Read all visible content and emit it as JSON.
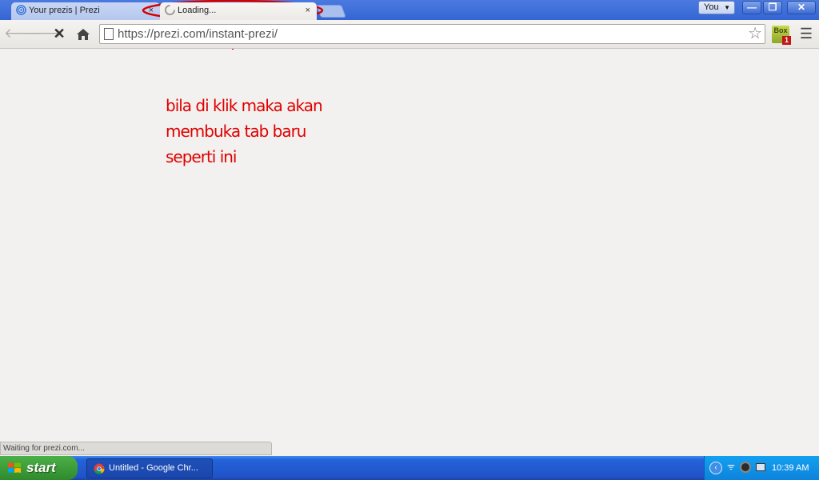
{
  "browser": {
    "tabs": [
      {
        "title": "Your prezis | Prezi",
        "icon": "prezi-icon",
        "active": false
      },
      {
        "title": "Loading...",
        "icon": "spinner-icon",
        "active": true
      }
    ],
    "tab_close_glyph": "×",
    "profile_label": "You",
    "window_controls": {
      "minimize": "—",
      "maximize": "❐",
      "close": "✕"
    },
    "url": "https://prezi.com/instant-prezi/",
    "extension": {
      "label": "Box",
      "badge": "1"
    },
    "status_text": "Waiting for prezi.com..."
  },
  "annotation": {
    "text": "bila di klik maka akan membuka tab baru seperti ini",
    "color": "#e00000"
  },
  "taskbar": {
    "start_label": "start",
    "items": [
      {
        "label": "Untitled - Google Chr...",
        "icon": "chrome-icon"
      }
    ],
    "clock": "10:39 AM"
  }
}
